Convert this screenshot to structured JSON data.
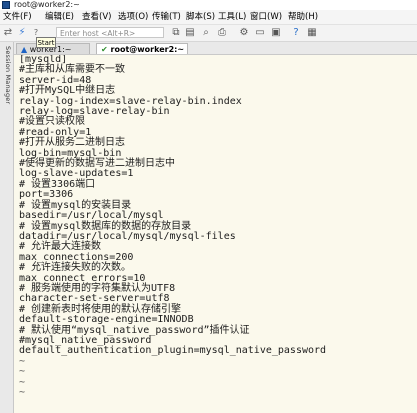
{
  "window": {
    "title": "root@worker2:~"
  },
  "menu": [
    "文件(F)",
    "编辑(E)",
    "查看(V)",
    "选项(O)",
    "传输(T)",
    "脚本(S)",
    "工具(L)",
    "窗口(W)",
    "帮助(H)"
  ],
  "toolbar": {
    "host_placeholder": "Enter host <Alt+R>",
    "tooltip": "Start",
    "icons": [
      "connect-icon",
      "quick-connect-icon",
      "reconnect-icon",
      "copy-icon",
      "paste-icon",
      "find-icon",
      "print-icon",
      "settings-icon",
      "keymap-icon",
      "sftp-icon",
      "help-icon",
      "monitor-icon"
    ]
  },
  "sidebar": {
    "label": "Session Manager"
  },
  "tabs": [
    {
      "label": "worker1:~",
      "status": "warning"
    },
    {
      "label": "root@worker2:~",
      "status": "connected"
    }
  ],
  "terminal": {
    "lines": [
      "[mysqld]",
      "#主库和从库需要不一致",
      "server-id=48",
      "#打开MySQL中继日志",
      "relay-log-index=slave-relay-bin.index",
      "relay-log=slave-relay-bin",
      "#设置只读权限",
      "#read-only=1",
      "#打开从服务二进制日志",
      "log-bin=mysql-bin",
      "#使得更新的数据写进二进制日志中",
      "log-slave-updates=1",
      "# 设置3306端口",
      "port=3306",
      "# 设置mysql的安装目录",
      "basedir=/usr/local/mysql",
      "# 设置mysql数据库的数据的存放目录",
      "datadir=/usr/local/mysql/mysql-files",
      "# 允许最大连接数",
      "max_connections=200",
      "# 允许连接失败的次数。",
      "max_connect_errors=10",
      "# 服务端使用的字符集默认为UTF8",
      "character-set-server=utf8",
      "# 创建新表时将使用的默认存储引擎",
      "default-storage-engine=INNODB",
      "# 默认使用“mysql_native_password”插件认证",
      "#mysql_native_password",
      "default_authentication_plugin=mysql_native_password",
      "~",
      "~",
      "~",
      "~"
    ]
  }
}
